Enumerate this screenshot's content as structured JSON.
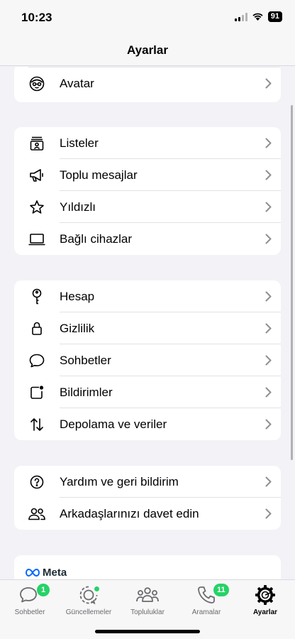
{
  "status_bar": {
    "time": "10:23",
    "battery": "91"
  },
  "nav": {
    "title": "Ayarlar"
  },
  "groups": [
    {
      "items": [
        {
          "label": "Avatar",
          "icon": "avatar-icon"
        }
      ]
    },
    {
      "items": [
        {
          "label": "Listeler",
          "icon": "lists-icon"
        },
        {
          "label": "Toplu mesajlar",
          "icon": "megaphone-icon"
        },
        {
          "label": "Yıldızlı",
          "icon": "star-icon"
        },
        {
          "label": "Bağlı cihazlar",
          "icon": "laptop-icon"
        }
      ]
    },
    {
      "items": [
        {
          "label": "Hesap",
          "icon": "key-icon"
        },
        {
          "label": "Gizlilik",
          "icon": "lock-icon"
        },
        {
          "label": "Sohbetler",
          "icon": "chat-bubble-icon"
        },
        {
          "label": "Bildirimler",
          "icon": "notification-icon"
        },
        {
          "label": "Depolama ve veriler",
          "icon": "arrows-up-down-icon"
        }
      ]
    },
    {
      "items": [
        {
          "label": "Yardım ve geri bildirim",
          "icon": "help-icon"
        },
        {
          "label": "Arkadaşlarınızı davet edin",
          "icon": "people-icon"
        }
      ]
    }
  ],
  "meta": {
    "label": "Meta"
  },
  "tabs": [
    {
      "label": "Sohbetler",
      "badge": "1",
      "icon": "chats-tab-icon"
    },
    {
      "label": "Güncellemeler",
      "icon": "updates-tab-icon"
    },
    {
      "label": "Topluluklar",
      "icon": "communities-tab-icon"
    },
    {
      "label": "Aramalar",
      "badge": "11",
      "icon": "calls-tab-icon"
    },
    {
      "label": "Ayarlar",
      "icon": "settings-tab-icon",
      "active": true
    }
  ],
  "colors": {
    "accent": "#25d366",
    "background": "#f2f2f7"
  }
}
